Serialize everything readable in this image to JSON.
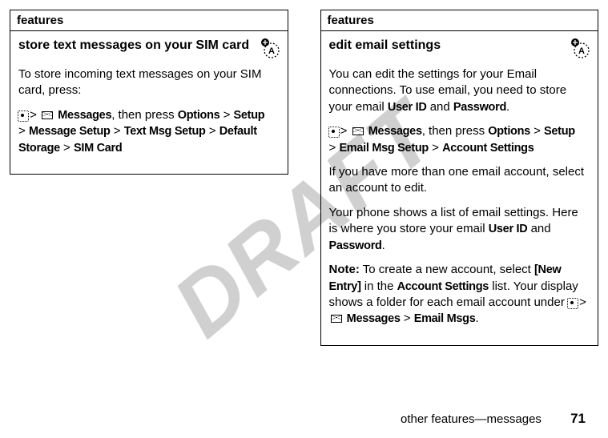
{
  "watermark": "DRAFT",
  "left": {
    "header": "features",
    "title": "store text messages on your SIM card",
    "p1a": "To store incoming text messages on your SIM card, press:",
    "nav1": "Messages",
    "nav2": ", then press ",
    "nav_options": "Options",
    "nav_setup": "Setup",
    "nav_msgsetup": "Message Setup",
    "nav_txtsetup": "Text Msg Setup",
    "nav_defstorage": "Default Storage",
    "nav_simcard": "SIM Card"
  },
  "right": {
    "header": "features",
    "title": "edit email settings",
    "p1": "You can edit the settings for your Email connections. To use email, you need to store your email ",
    "userid": "User ID",
    "and": " and ",
    "password": "Password",
    "period": ".",
    "nav1": "Messages",
    "nav2": ", then press ",
    "nav_options": "Options",
    "nav_setup": "Setup",
    "nav_emailsetup": "Email Msg Setup",
    "nav_acctsettings": "Account Settings",
    "p3": "If you have more than one email account, select an account to edit.",
    "p4a": "Your phone shows a list of email settings. Here is where you store your email ",
    "note_label": "Note:",
    "note_a": " To create a new account, select ",
    "note_newentry": "[New Entry]",
    "note_b": " in the ",
    "note_acct": "Account Settings",
    "note_c": " list. Your display shows a folder for each email account under ",
    "note_msgs": "Messages",
    "note_emailmsgs": "Email Msgs"
  },
  "footer": {
    "text": "other features—messages",
    "page": "71"
  }
}
